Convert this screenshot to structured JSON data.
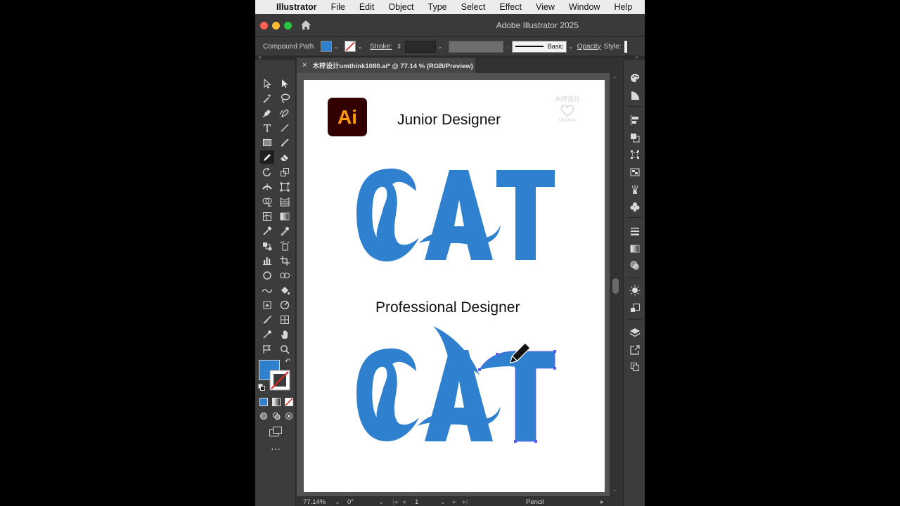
{
  "menubar": {
    "app_name": "Illustrator",
    "items": [
      "File",
      "Edit",
      "Object",
      "Type",
      "Select",
      "Effect",
      "View",
      "Window",
      "Help"
    ]
  },
  "window": {
    "title": "Adobe Illustrator 2025"
  },
  "control_bar": {
    "selection_type": "Compound Path",
    "fill_color": "#2f80ce",
    "stroke_label": "Stroke:",
    "stroke_style": "Basic",
    "opacity_label": "Opacity",
    "style_label": "Style:"
  },
  "document": {
    "tab_title": "木梓设计umthink1080.ai* @ 77.14 % (RGB/Preview)",
    "close_icon": "×"
  },
  "artboard": {
    "logo_text": "Ai",
    "heading_1": "Junior Designer",
    "heading_2": "Professional Designer",
    "watermark_text": "木梓设计",
    "watermark_sub": "UMThink",
    "brand_color": "#2f80ce"
  },
  "status_bar": {
    "zoom": "77.14%",
    "rotation": "0°",
    "artboard_number": "1",
    "current_tool": "Pencil"
  },
  "colors": {
    "accent_blue": "#2f80ce",
    "ai_logo_bg": "#330000",
    "ai_logo_fg": "#ff9a00",
    "ui_dark": "#323232"
  }
}
